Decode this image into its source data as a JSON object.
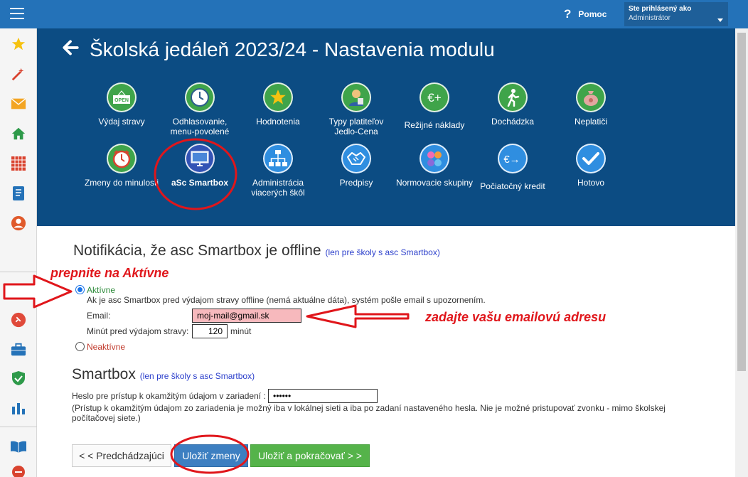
{
  "topbar": {
    "help_label": "Pomoc",
    "user_line1": "Ste prihlásený ako",
    "user_line2": "Administrátor"
  },
  "sidebar_icons": [
    "star-icon",
    "magic-wand-icon",
    "mail-icon",
    "home-icon",
    "calendar-grid-icon",
    "book-icon",
    "user-icon",
    "pin-icon",
    "briefcase-icon",
    "shield-icon",
    "chart-icon",
    "open-book-icon",
    "stop-icon"
  ],
  "header": {
    "title": "Školská jedáleň 2023/24 - Nastavenia modulu",
    "tiles_row1": [
      {
        "label": "Výdaj stravy",
        "icon": "open-sign-icon"
      },
      {
        "label": "Odhlasovanie, menu-povolené",
        "icon": "clock-icon"
      },
      {
        "label": "Hodnotenia",
        "icon": "star-icon"
      },
      {
        "label": "Typy platiteľov Jedlo-Cena",
        "icon": "person-icon"
      },
      {
        "label": "Režijné náklady",
        "icon": "euro-plus-icon"
      },
      {
        "label": "Dochádzka",
        "icon": "walking-icon"
      },
      {
        "label": "Neplatiči",
        "icon": "money-bag-icon"
      }
    ],
    "tiles_row2": [
      {
        "label": "Zmeny do minulosti",
        "icon": "clock-alarm-icon"
      },
      {
        "label": "aSc Smartbox",
        "icon": "monitor-icon"
      },
      {
        "label": "Administrácia viacerých škôl",
        "icon": "network-icon"
      },
      {
        "label": "Predpisy",
        "icon": "handshake-icon"
      },
      {
        "label": "Normovacie skupiny",
        "icon": "groups-icon"
      },
      {
        "label": "Počiatočný kredit",
        "icon": "euro-arrow-icon"
      },
      {
        "label": "Hotovo",
        "icon": "check-icon"
      }
    ]
  },
  "notification": {
    "heading": "Notifikácia, že asc Smartbox je offline",
    "heading_note": "(len pre školy s asc Smartbox)",
    "annotation_top": "prepnite na Aktívne",
    "active_label": "Aktívne",
    "description": "Ak je asc Smartbox pred výdajom stravy offline (nemá aktuálne dáta), systém pošle email s upozornením.",
    "email_label": "Email:",
    "email_value": "moj-mail@gmail.sk",
    "annotation_email": "zadajte vašu emailovú adresu",
    "minutes_label": "Minút pred výdajom stravy:",
    "minutes_value": "120",
    "minutes_unit": "minút",
    "inactive_label": "Neaktívne"
  },
  "smartbox": {
    "heading": "Smartbox",
    "heading_note": "(len pre školy s asc Smartbox)",
    "password_label": "Heslo pre prístup k okamžitým údajom v zariadení :",
    "password_value": "••••••",
    "note": "(Prístup k okamžitým údajom zo zariadenia je možný iba v lokálnej sieti a iba po zadaní nastaveného hesla. Nie je možné pristupovať zvonku - mimo školskej počítačovej siete.)"
  },
  "buttons": {
    "previous": "< < Predchádzajúci",
    "save": "Uložiť zmeny",
    "save_continue": "Uložiť a pokračovať > >"
  },
  "colors": {
    "topbar": "#2472b8",
    "header": "#0c4c83",
    "annotation": "#e0161b",
    "save_button": "#3d7fc1",
    "save_continue_button": "#55b34a"
  }
}
